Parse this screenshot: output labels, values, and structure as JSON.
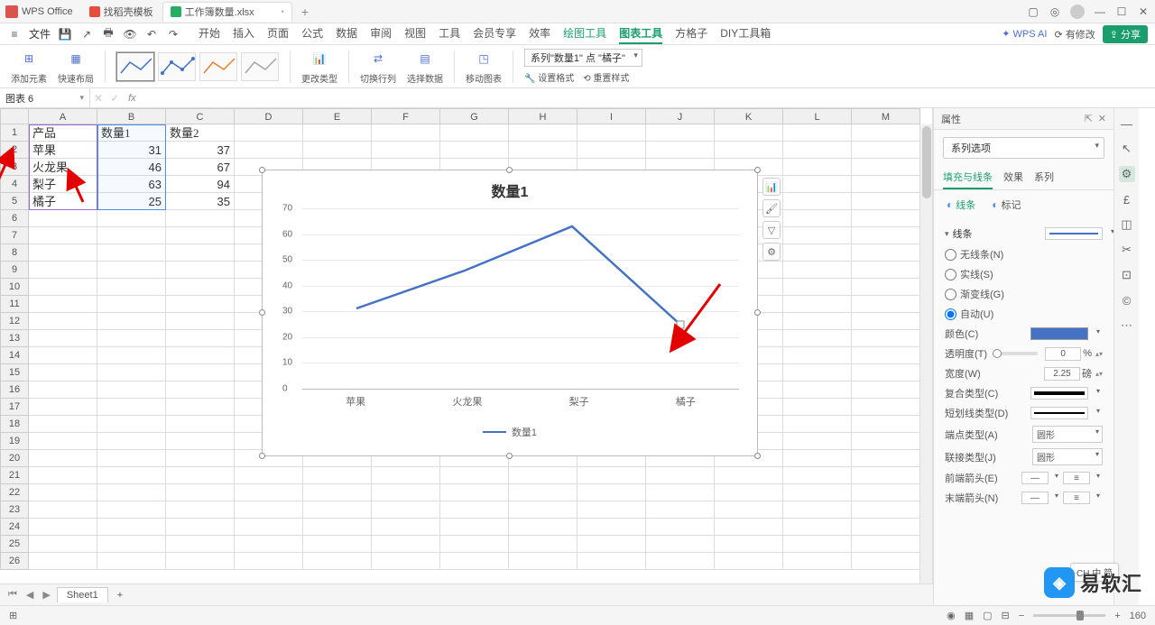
{
  "app": {
    "name": "WPS Office"
  },
  "tabs_top": [
    {
      "label": "找稻壳模板",
      "icon": "red"
    },
    {
      "label": "工作簿数量.xlsx",
      "icon": "green",
      "active": true
    }
  ],
  "menubar": {
    "file": "文件",
    "tabs": [
      "开始",
      "插入",
      "页面",
      "公式",
      "数据",
      "审阅",
      "视图",
      "工具",
      "会员专享",
      "效率",
      "绘图工具",
      "图表工具",
      "方格子",
      "DIY工具箱"
    ],
    "active": "图表工具",
    "green_extra": "绘图工具",
    "ai": "WPS AI",
    "modified": "有修改",
    "share": "分享"
  },
  "ribbon": {
    "add_elem": "添加元素",
    "quick_layout": "快速布局",
    "change_type": "更改类型",
    "switch_rowcol": "切换行列",
    "select_data": "选择数据",
    "move_chart": "移动图表",
    "series_sel": "系列\"数量1\" 点 \"橘子\"",
    "set_format": "设置格式",
    "reset_style": "重置样式"
  },
  "namebox": "图表 6",
  "fx_label": "fx",
  "cols": [
    "A",
    "B",
    "C",
    "D",
    "E",
    "F",
    "G",
    "H",
    "I",
    "J",
    "K",
    "L",
    "M"
  ],
  "table": {
    "headers": [
      "产品",
      "数量1",
      "数量2"
    ],
    "rows": [
      [
        "苹果",
        "31",
        "37"
      ],
      [
        "火龙果",
        "46",
        "67"
      ],
      [
        "梨子",
        "63",
        "94"
      ],
      [
        "橘子",
        "25",
        "35"
      ]
    ]
  },
  "chart_data": {
    "type": "line",
    "title": "数量1",
    "categories": [
      "苹果",
      "火龙果",
      "梨子",
      "橘子"
    ],
    "series": [
      {
        "name": "数量1",
        "values": [
          31,
          46,
          63,
          25
        ],
        "color": "#4472C4"
      }
    ],
    "ylim": [
      0,
      70
    ],
    "y_ticks": [
      0,
      10,
      20,
      30,
      40,
      50,
      60,
      70
    ],
    "xlabel": "",
    "ylabel": "",
    "legend": "数量1"
  },
  "prop": {
    "panel_title": "属性",
    "series_opts": "系列选项",
    "tabs": [
      "填充与线条",
      "效果",
      "系列"
    ],
    "subtabs": {
      "line": "线条",
      "marker": "标记"
    },
    "section_line": "线条",
    "radio_none": "无线条(N)",
    "radio_solid": "实线(S)",
    "radio_gradient": "渐变线(G)",
    "radio_auto": "自动(U)",
    "color": "颜色(C)",
    "transparency": "透明度(T)",
    "transparency_val": "0",
    "transparency_unit": "%",
    "width": "宽度(W)",
    "width_val": "2.25",
    "width_unit": "磅",
    "compound": "复合类型(C)",
    "dash": "短划线类型(D)",
    "cap": "端点类型(A)",
    "cap_val": "圆形",
    "join": "联接类型(J)",
    "join_val": "圆形",
    "arrow_start": "前端箭头(E)",
    "arrow_end": "末端箭头(N)"
  },
  "sheet_tab": "Sheet1",
  "ime": "CH 中 简",
  "zoom": "160",
  "watermark": "易软汇"
}
